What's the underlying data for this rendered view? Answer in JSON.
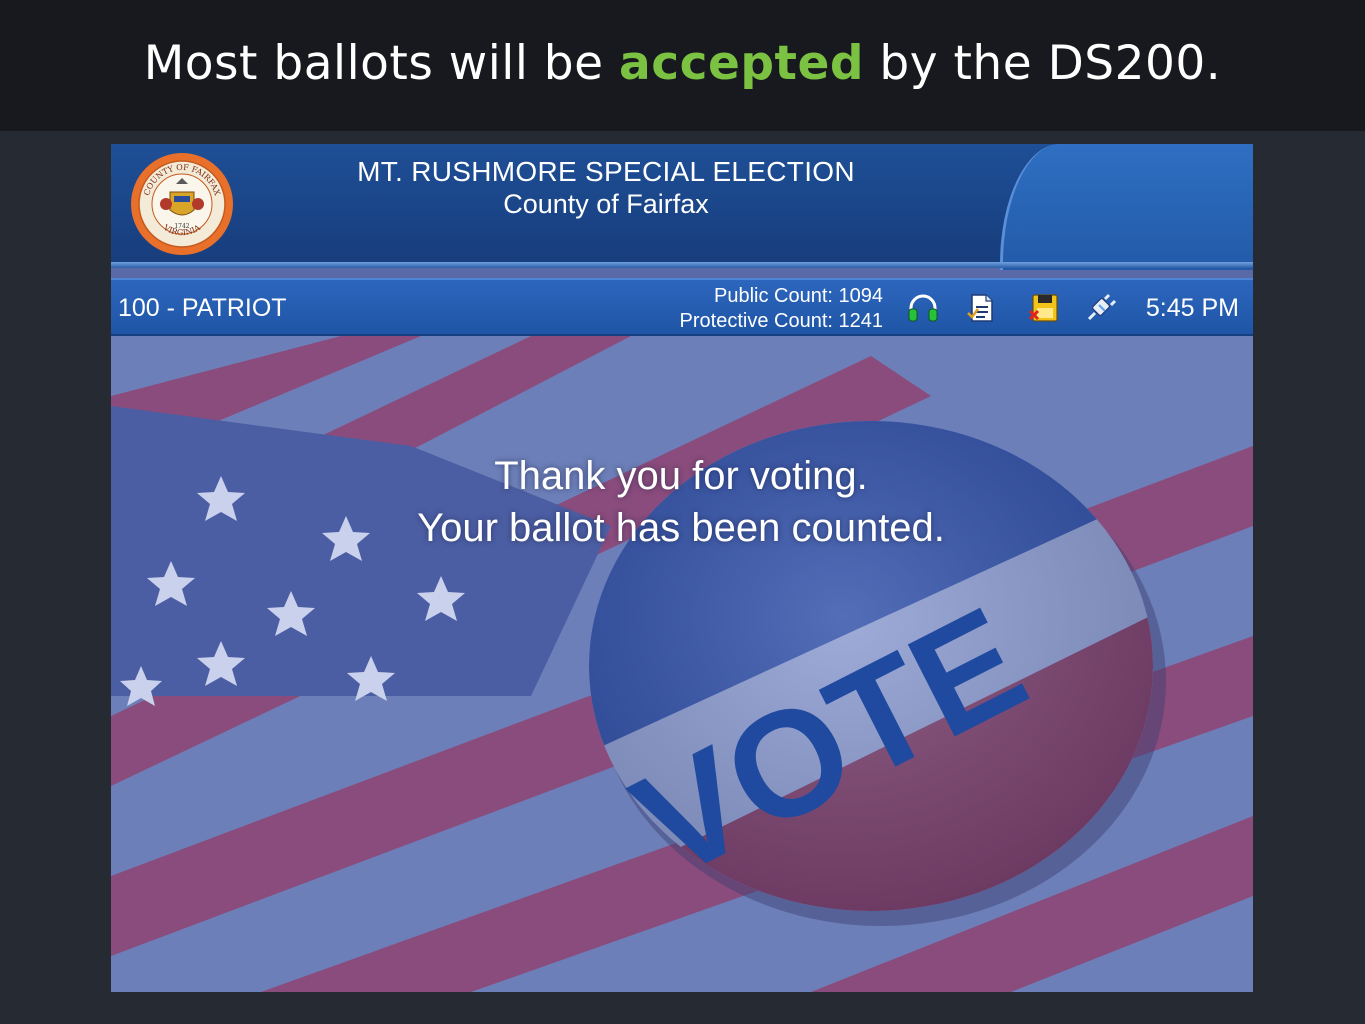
{
  "slide": {
    "title_before": "Most ballots will be ",
    "title_highlight": "accepted",
    "title_after": " by the DS200.",
    "highlight_color": "#7bc142"
  },
  "header": {
    "election_title": "MT. RUSHMORE SPECIAL ELECTION",
    "county_name": "County of Fairfax",
    "seal_icon": "county-seal-icon",
    "seal_text_top": "COUNTY OF FAIRFAX",
    "seal_text_bottom": "VIRGINIA",
    "seal_year": "1742"
  },
  "status": {
    "precinct": "100 - PATRIOT",
    "public_count_label": "Public Count: 1094",
    "protective_count_label": "Protective Count: 1241",
    "icons": [
      "headphones-icon",
      "ballot-report-icon",
      "memory-stick-warning-icon",
      "power-plug-icon"
    ],
    "time": "5:45 PM"
  },
  "main": {
    "message_line1": "Thank you for voting.",
    "message_line2": "Your ballot has been counted.",
    "button_text": "VOTE"
  },
  "colors": {
    "header_blue": "#1a4487",
    "status_blue": "#2560b0",
    "flag_red": "#8a3a6a",
    "vote_blue": "#1f4aa0"
  }
}
